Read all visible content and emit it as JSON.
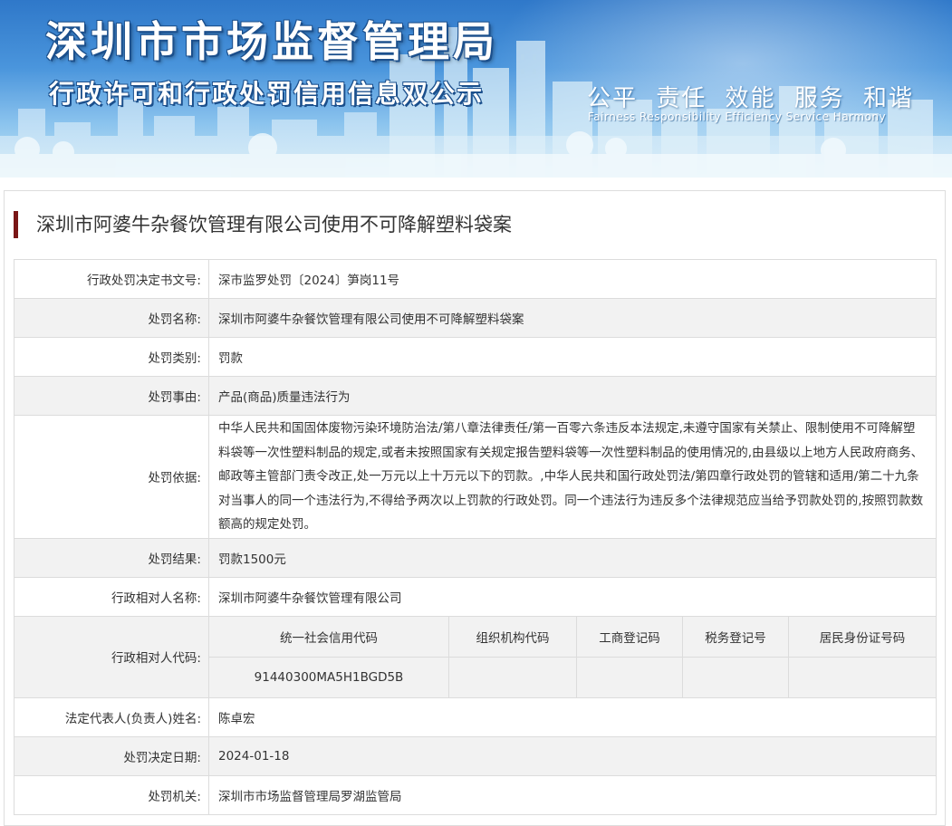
{
  "banner": {
    "title": "深圳市市场监督管理局",
    "subtitle": "行政许可和行政处罚信用信息双公示",
    "slogan_cn": "公平  责任  效能  服务  和谐",
    "slogan_en": "Fairness  Responsibility  Efficiency  Service  Harmony"
  },
  "case": {
    "title": "深圳市阿婆牛杂餐饮管理有限公司使用不可降解塑料袋案"
  },
  "fields": {
    "doc_no_label": "行政处罚决定书文号:",
    "doc_no": "深市监罗处罚〔2024〕笋岗11号",
    "name_label": "处罚名称:",
    "name": "深圳市阿婆牛杂餐饮管理有限公司使用不可降解塑料袋案",
    "category_label": "处罚类别:",
    "category": "罚款",
    "cause_label": "处罚事由:",
    "cause": "产品(商品)质量违法行为",
    "basis_label": "处罚依据:",
    "basis": "中华人民共和国固体废物污染环境防治法/第八章法律责任/第一百零六条违反本法规定,未遵守国家有关禁止、限制使用不可降解塑料袋等一次性塑料制品的规定,或者未按照国家有关规定报告塑料袋等一次性塑料制品的使用情况的,由县级以上地方人民政府商务、邮政等主管部门责令改正,处一万元以上十万元以下的罚款。,中华人民共和国行政处罚法/第四章行政处罚的管辖和适用/第二十九条对当事人的同一个违法行为,不得给予两次以上罚款的行政处罚。同一个违法行为违反多个法律规范应当给予罚款处罚的,按照罚款数额高的规定处罚。",
    "result_label": "处罚结果:",
    "result": "罚款1500元",
    "party_label": "行政相对人名称:",
    "party": "深圳市阿婆牛杂餐饮管理有限公司",
    "party_code_label": "行政相对人代码:",
    "codes": {
      "h_credit": "统一社会信用代码",
      "h_org": "组织机构代码",
      "h_biz": "工商登记码",
      "h_tax": "税务登记号",
      "h_id": "居民身份证号码",
      "v_credit": "91440300MA5H1BGD5B",
      "v_org": "",
      "v_biz": "",
      "v_tax": "",
      "v_id": ""
    },
    "legal_rep_label": "法定代表人(负责人)姓名:",
    "legal_rep": "陈卓宏",
    "date_label": "处罚决定日期:",
    "date": "2024-01-18",
    "authority_label": "处罚机关:",
    "authority": "深圳市市场监督管理局罗湖监管局"
  }
}
